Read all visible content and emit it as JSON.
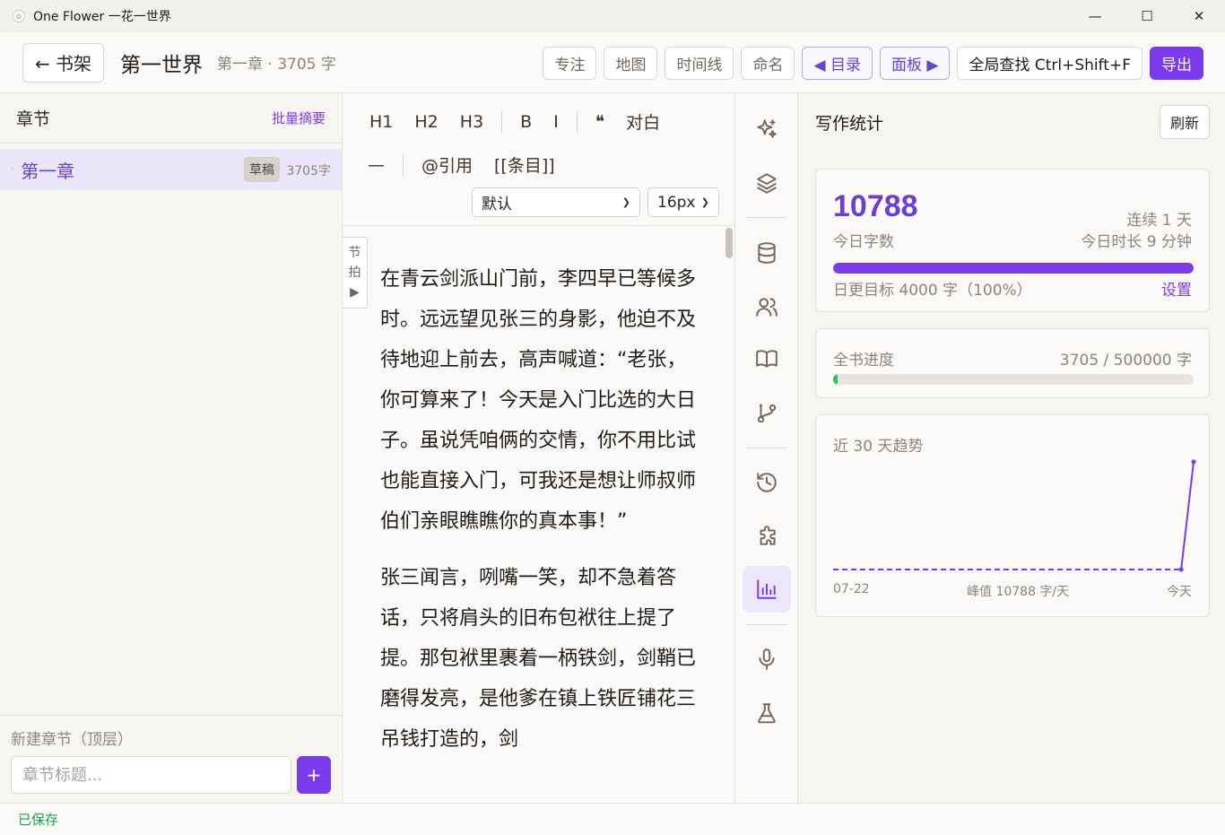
{
  "window": {
    "title": "One Flower 一花一世界",
    "minimize": "—",
    "maximize": "☐",
    "close": "✕"
  },
  "toolbar": {
    "back_label": "← 书架",
    "book_title": "第一世界",
    "chapter_meta": "第一章 · 3705 字",
    "buttons": {
      "focus": "专注",
      "map": "地图",
      "timeline": "时间线",
      "naming": "命名",
      "toc": "◀ 目录",
      "panel": "面板 ▶",
      "search": "全局查找 Ctrl+Shift+F",
      "export": "导出"
    }
  },
  "sidebar": {
    "title": "章节",
    "batch_summary": "批量摘要",
    "chapters": [
      {
        "name": "第一章",
        "status": "草稿",
        "words": "3705字"
      }
    ],
    "new_label": "新建章节（顶层）",
    "new_placeholder": "章节标题...",
    "add_label": "+"
  },
  "editor": {
    "format": {
      "h1": "H1",
      "h2": "H2",
      "h3": "H3",
      "bold": "B",
      "italic": "I",
      "quote": "❝",
      "dialogue": "对白",
      "dash": "—",
      "ref": "@引用",
      "entry": "[[条目]]"
    },
    "font_select": "默认",
    "size_select": "16px",
    "beat_tab": {
      "line1": "节",
      "line2": "拍",
      "arrow": "▶"
    },
    "paragraphs": [
      "在青云剑派山门前，李四早已等候多时。远远望见张三的身影，他迫不及待地迎上前去，高声喊道：“老张，你可算来了！今天是入门比选的大日子。虽说凭咱俩的交情，你不用比试也能直接入门，可我还是想让师叔师伯们亲眼瞧瞧你的真本事！”",
      "张三闻言，咧嘴一笑，却不急着答话，只将肩头的旧布包袱往上提了提。那包袱里裹着一柄铁剑，剑鞘已磨得发亮，是他爹在镇上铁匠铺花三吊钱打造的，剑"
    ]
  },
  "rail": {
    "icons": [
      "sparkles-icon",
      "layers-icon",
      "database-icon",
      "users-icon",
      "book-icon",
      "git-branch-icon",
      "history-icon",
      "puzzle-icon",
      "bar-chart-icon",
      "microphone-icon",
      "flask-icon"
    ],
    "active": "bar-chart-icon"
  },
  "stats": {
    "title": "写作统计",
    "refresh": "刷新",
    "today_words": "10788",
    "today_label": "今日字数",
    "streak": "连续 1 天",
    "today_time": "今日时长 9 分钟",
    "goal_text": "日更目标 4000 字（100%）",
    "goal_progress": 1.0,
    "goal_link": "设置",
    "book_progress_label": "全书进度",
    "book_progress_value": "3705 / 500000 字",
    "book_progress": 0.0074,
    "trend_title": "近 30 天趋势",
    "trend_start": "07-22",
    "trend_peak": "峰值 10788 字/天",
    "trend_end": "今天",
    "accent": "#7c3aed",
    "progress_green": "#22c55e"
  },
  "chart_data": {
    "type": "line",
    "x": [
      "07-22",
      "",
      "",
      "",
      "",
      "",
      "",
      "",
      "",
      "",
      "",
      "",
      "",
      "",
      "",
      "",
      "",
      "",
      "",
      "",
      "",
      "",
      "",
      "",
      "",
      "",
      "",
      "",
      "",
      "今天"
    ],
    "series": [
      {
        "values": [
          0,
          0,
          0,
          0,
          0,
          0,
          0,
          0,
          0,
          0,
          0,
          0,
          0,
          0,
          0,
          0,
          0,
          0,
          0,
          0,
          0,
          0,
          0,
          0,
          0,
          0,
          0,
          0,
          0,
          10788
        ]
      }
    ],
    "ylim": [
      0,
      10788
    ]
  },
  "status": {
    "saved": "已保存"
  }
}
